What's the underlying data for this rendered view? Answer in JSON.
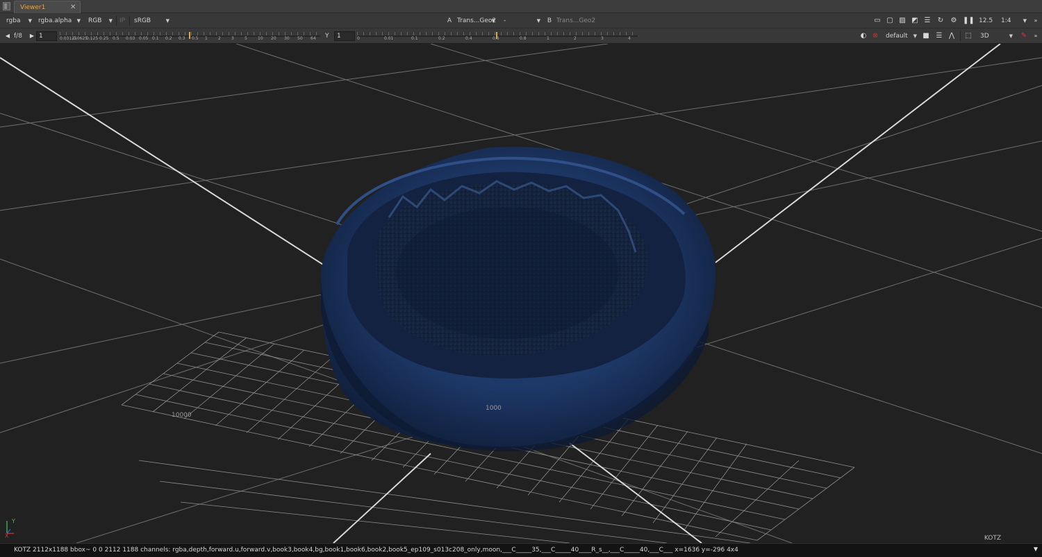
{
  "tab": {
    "title": "Viewer1",
    "close": "✕"
  },
  "toolbar1": {
    "channels": "rgba",
    "alpha_channel": "rgba.alpha",
    "display_channels": "RGB",
    "ip_label": "IP",
    "colorspace": "sRGB",
    "input_a_label": "A",
    "input_a_value": "Trans...Geo2",
    "compare_mode": "-",
    "input_b_label": "B",
    "input_b_value": "Trans...Geo2",
    "zoom": "12.5",
    "proxy": "1:4"
  },
  "toolbar2": {
    "fstop": "f/8",
    "gain_value": "1",
    "gain_ticks": [
      "0.03125",
      "0.0625",
      "0.125",
      "0.25",
      "0.5",
      "1",
      "2",
      "4",
      "8",
      "16",
      "32",
      "64"
    ],
    "gain_ticks_display": [
      "0.03125",
      "0.0625",
      "0.125",
      "0.25",
      "0.5",
      "0.03",
      "0.05",
      "0.1",
      "0.2",
      "0.3",
      "0.5",
      "1",
      "2",
      "3",
      "5",
      "10",
      "20",
      "30",
      "50",
      "64"
    ],
    "y_label": "Y",
    "gamma_value": "1",
    "gamma_ticks_display": [
      "0",
      "0.01",
      "0.1",
      "0.2",
      "0.4",
      "0.6",
      "0.8",
      "1",
      "2",
      "3",
      "4"
    ],
    "lut": "default",
    "view_mode": "3D"
  },
  "viewport": {
    "grid_label_a": "10000",
    "grid_label_b": "1000",
    "axis_y": "Y",
    "axis_x": "X",
    "viewer_tag": "KOTZ"
  },
  "statusbar": {
    "text": "KOTZ 2112x1188  bbox~ 0 0 2112 1188 channels: rgba,depth,forward.u,forward.v,book3,book4,bg,book1,book6,book2,book5_ep109_s013c208_only,moon,___C_____35,___C_____40____R_s__,___C_____40,___C___  x=1636 y=-296 4x4"
  },
  "colors": {
    "background": "#212121",
    "grid": "#8a8a8a",
    "axis_lines": "#d9d9d9",
    "bowl": "#1e3a6e",
    "accent": "#e3a84a"
  },
  "icons": [
    "window-grip-icon",
    "frame-icon",
    "region-icon",
    "stripes-icon",
    "wipe-icon",
    "list-icon",
    "refresh-icon",
    "gear-icon",
    "pause-icon",
    "dropdown-icon",
    "light-icon",
    "clear-icon",
    "camera-icon",
    "menu-icon",
    "histogram-icon",
    "roi-icon",
    "pick-icon"
  ]
}
